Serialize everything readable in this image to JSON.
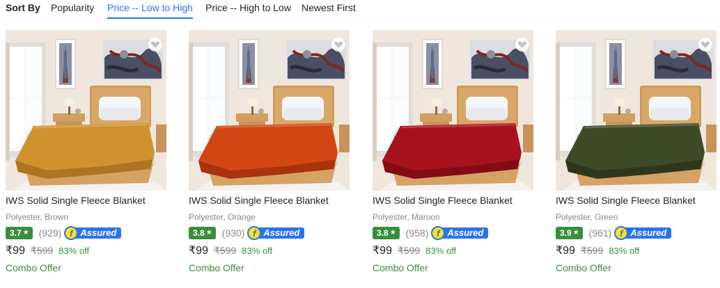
{
  "sort": {
    "label": "Sort By",
    "options": [
      "Popularity",
      "Price -- Low to High",
      "Price -- High to Low",
      "Newest First"
    ],
    "active": "Price -- Low to High"
  },
  "colors": {
    "accent": "#2874f0",
    "rating_green": "#388e3c",
    "muted": "#878787",
    "assured_yellow": "#ffe11b"
  },
  "products": [
    {
      "title": "IWS Solid Single Fleece Blanket",
      "subtitle": "Polyester, Brown",
      "rating": "3.7",
      "reviews": "(929)",
      "assured": "Assured",
      "price": "₹99",
      "mrp": "₹599",
      "discount": "83% off",
      "offer": "Combo Offer",
      "blanket_color": "#d0922f",
      "blanket_shade": "#a96e1f"
    },
    {
      "title": "IWS Solid Single Fleece Blanket",
      "subtitle": "Polyester, Orange",
      "rating": "3.8",
      "reviews": "(930)",
      "assured": "Assured",
      "price": "₹99",
      "mrp": "₹599",
      "discount": "83% off",
      "offer": "Combo Offer",
      "blanket_color": "#d24614",
      "blanket_shade": "#a3300b"
    },
    {
      "title": "IWS Solid Single Fleece Blanket",
      "subtitle": "Polyester, Maroon",
      "rating": "3.8",
      "reviews": "(958)",
      "assured": "Assured",
      "price": "₹99",
      "mrp": "₹599",
      "discount": "83% off",
      "offer": "Combo Offer",
      "blanket_color": "#a8121e",
      "blanket_shade": "#7c0a14"
    },
    {
      "title": "IWS Solid Single Fleece Blanket",
      "subtitle": "Polyester, Green",
      "rating": "3.9",
      "reviews": "(961)",
      "assured": "Assured",
      "price": "₹99",
      "mrp": "₹599",
      "discount": "83% off",
      "offer": "Combo Offer",
      "blanket_color": "#3f4a28",
      "blanket_shade": "#2c3419"
    }
  ]
}
